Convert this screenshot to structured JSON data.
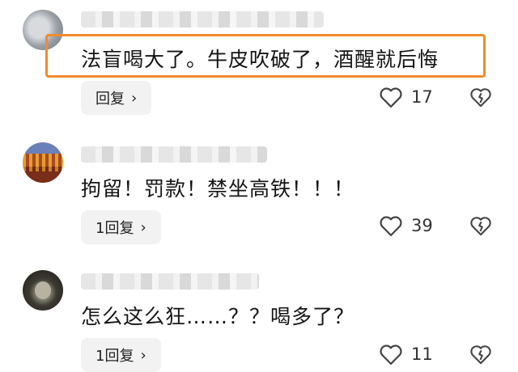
{
  "comments": [
    {
      "text": "法盲喝大了。牛皮吹破了，酒醒就后悔",
      "reply_label": "回复",
      "likes": "17",
      "highlighted": true
    },
    {
      "text": "拘留！罚款！禁坐高铁！！！",
      "reply_label": "1回复",
      "likes": "39"
    },
    {
      "text": "怎么这么狂……？？喝多了？",
      "reply_label": "1回复",
      "likes": "11"
    }
  ],
  "icons": {
    "like": "heart-outline-icon",
    "dislike": "broken-heart-icon",
    "reply_chevron": "chevron-right-icon"
  },
  "colors": {
    "highlight": "#f28a2e",
    "reply_bg": "#f2f2f2"
  }
}
